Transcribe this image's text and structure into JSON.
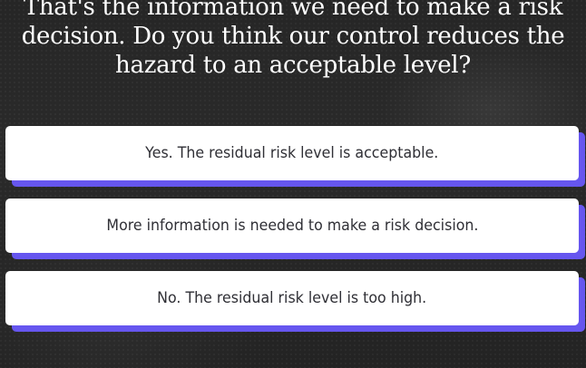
{
  "question": {
    "text": "That's the information we need to make a risk decision. Do you think our control reduces the hazard to an acceptable level?"
  },
  "answers": [
    {
      "label": "Yes. The residual risk level is acceptable."
    },
    {
      "label": "More information is needed to make a risk decision."
    },
    {
      "label": "No. The residual risk level is too high."
    }
  ],
  "colors": {
    "background": "#262626",
    "card": "#ffffff",
    "card_shadow": "#6656ef",
    "question_text": "#ffffff",
    "answer_text": "#2f2f35"
  }
}
